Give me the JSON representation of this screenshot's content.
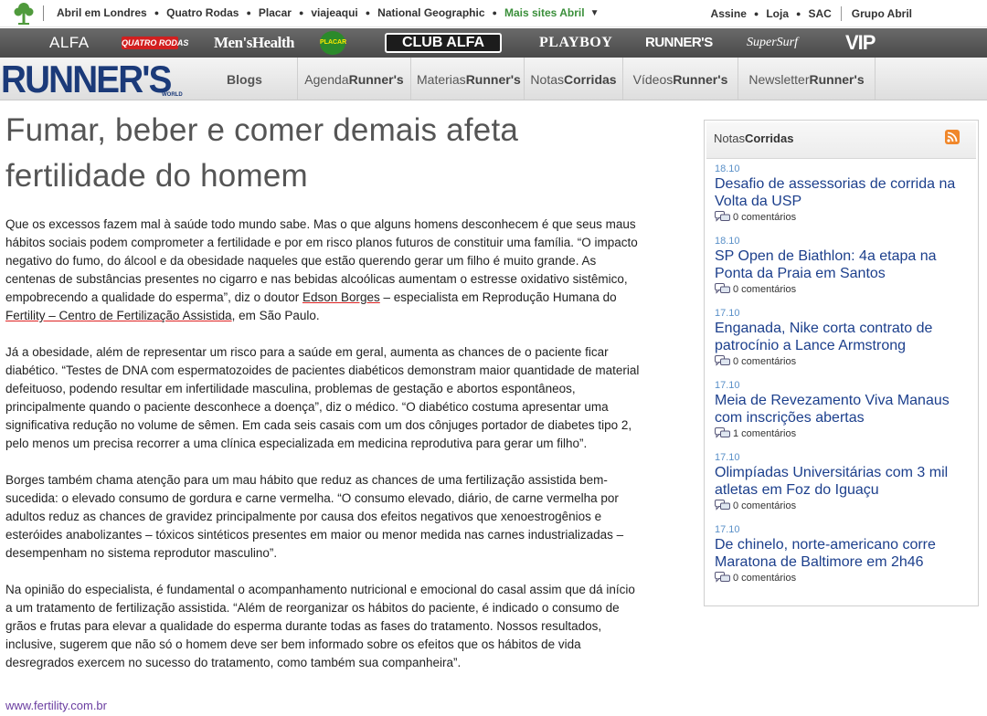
{
  "topbar": {
    "left_links": [
      "Abril em Londres",
      "Quatro Rodas",
      "Placar",
      "viajeaqui",
      "National Geographic"
    ],
    "more_sites": "Mais sites Abril",
    "right_links": [
      "Assine",
      "Loja",
      "SAC"
    ],
    "group": "Grupo Abril"
  },
  "brands": {
    "alfa": "ALFA",
    "quatro_rodas": "QUATRO RODAS",
    "mens_health": "Men'sHealth",
    "placar": "PLACAR",
    "club_alfa": "CLUB ALFA",
    "playboy": "PLAYBOY",
    "runners": "RUNNER'S",
    "supersurf": "SuperSurf",
    "vip": "VIP"
  },
  "site": {
    "logo": "RUNNER'S",
    "logo_sub": "WORLD"
  },
  "mainnav": {
    "blogs": "Blogs",
    "items": [
      {
        "pre": "Agenda",
        "bold": "Runner's"
      },
      {
        "pre": "Materias",
        "bold": "Runner's"
      },
      {
        "pre": "Notas",
        "bold": "Corridas"
      },
      {
        "pre": "Vídeos",
        "bold": "Runner's"
      },
      {
        "pre": "Newsletter",
        "bold": "Runner's"
      }
    ]
  },
  "article": {
    "title": "Fumar, beber e comer demais afeta fertilidade do homem",
    "p1_a": "Que os excessos fazem mal à saúde todo mundo sabe. Mas o que alguns homens desconhecem é que seus maus hábitos sociais podem comprometer a fertilidade e por em risco planos futuros de constituir uma família. “O impacto negativo do fumo, do álcool e da obesidade naqueles que estão querendo gerar um filho é muito grande. As centenas de substâncias presentes no cigarro e nas bebidas alcoólicas aumentam o estresse oxidativo sistêmico, empobrecendo a qualidade do esperma”, diz o doutor ",
    "p1_link1": "Edson Borges",
    "p1_b": " – especialista em Reprodução Humana do ",
    "p1_link2": "Fertility – Centro de Fertilização Assistida",
    "p1_c": ", em São Paulo.",
    "p2": "Já a obesidade, além de representar um risco para a saúde em geral, aumenta as chances de o paciente ficar diabético. “Testes de DNA com espermatozoides de pacientes diabéticos demonstram maior quantidade de material defeituoso, podendo resultar em infertilidade masculina, problemas de gestação e abortos espontâneos, principalmente quando o paciente desconhece a doença”, diz o médico. “O diabético costuma apresentar uma significativa redução no volume de sêmen. Em cada seis casais com um dos cônjuges portador de diabetes tipo 2, pelo menos um precisa recorrer a uma clínica especializada em medicina reprodutiva para gerar um filho”.",
    "p3": "Borges também chama atenção para um mau hábito que reduz as chances de uma fertilização assistida bem-sucedida: o elevado consumo de gordura e carne vermelha. “O consumo elevado, diário, de carne vermelha por adultos reduz as chances de gravidez principalmente por causa dos efeitos negativos que xenoestrogênios e esteróides anabolizantes – tóxicos sintéticos presentes em maior ou menor medida nas carnes industrializadas – desempenham no sistema reprodutor masculino”.",
    "p4": "Na opinião do especialista, é fundamental o acompanhamento nutricional e emocional do casal assim que dá início a um tratamento de fertilização assistida. “Além de reorganizar os hábitos do paciente, é indicado o consumo de grãos e frutas para elevar a qualidade do esperma durante todas as fases do tratamento. Nossos resultados, inclusive, sugerem que não só o homem deve ser bem informado sobre os efeitos que os hábitos de vida desregrados exercem no sucesso do tratamento, como também sua companheira”.",
    "source_link": "www.fertility.com.br"
  },
  "sidebar": {
    "head_pre": "Notas",
    "head_bold": "Corridas",
    "items": [
      {
        "date": "18.10",
        "title": "Desafio de assessorias de corrida na Volta da USP",
        "comments": "0 comentários"
      },
      {
        "date": "18.10",
        "title": "SP Open de Biathlon: 4a etapa na Ponta da Praia em Santos",
        "comments": "0 comentários"
      },
      {
        "date": "17.10",
        "title": "Enganada, Nike corta contrato de patrocínio a Lance Armstrong",
        "comments": "0 comentários"
      },
      {
        "date": "17.10",
        "title": "Meia de Revezamento Viva Manaus com inscrições abertas",
        "comments": "1 comentários"
      },
      {
        "date": "17.10",
        "title": "Olimpíadas Universitárias com 3 mil atletas em Foz do Iguaçu",
        "comments": "0 comentários"
      },
      {
        "date": "17.10",
        "title": "De chinelo, norte-americano corre Maratona de Baltimore em 2h46",
        "comments": "0 comentários"
      }
    ]
  }
}
